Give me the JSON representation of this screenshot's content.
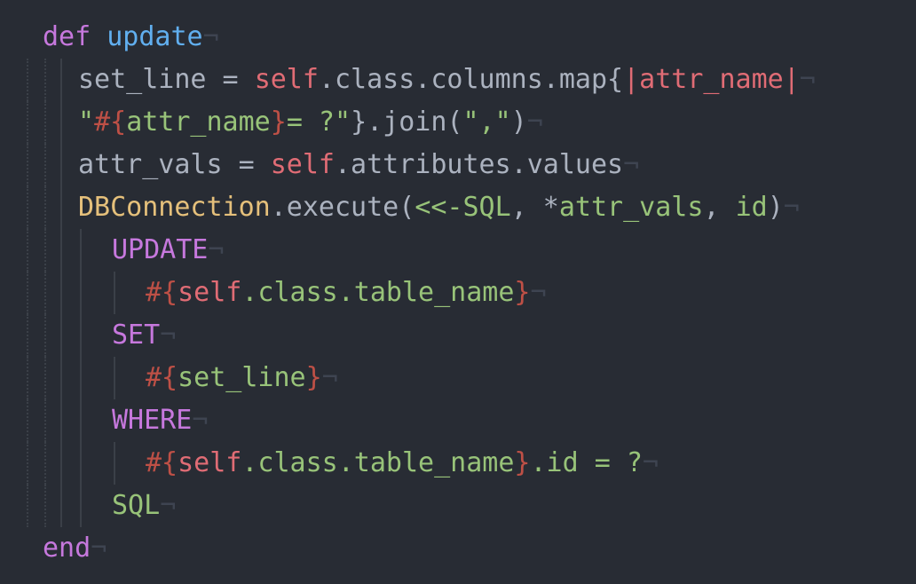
{
  "editor": {
    "language": "ruby",
    "eol_marker": "¬",
    "lines": [
      {
        "tokens": [
          {
            "t": "def",
            "c": "c-kw"
          },
          {
            "t": " ",
            "c": "c-plain"
          },
          {
            "t": "update",
            "c": "c-fn"
          }
        ]
      },
      {
        "tokens": [
          {
            "t": "set_line",
            "c": "c-plain"
          },
          {
            "t": " = ",
            "c": "c-plain"
          },
          {
            "t": "self",
            "c": "c-self"
          },
          {
            "t": ".class.columns.map{",
            "c": "c-plain"
          },
          {
            "t": "|attr_name|",
            "c": "c-var"
          }
        ]
      },
      {
        "tokens": [
          {
            "t": "\"",
            "c": "c-str"
          },
          {
            "t": "#{",
            "c": "c-interp"
          },
          {
            "t": "attr_name",
            "c": "c-str"
          },
          {
            "t": "}",
            "c": "c-interp"
          },
          {
            "t": "= ?\"",
            "c": "c-str"
          },
          {
            "t": "}.join(",
            "c": "c-plain"
          },
          {
            "t": "\",\"",
            "c": "c-str"
          },
          {
            "t": ")",
            "c": "c-plain"
          }
        ]
      },
      {
        "tokens": [
          {
            "t": "attr_vals",
            "c": "c-plain"
          },
          {
            "t": " = ",
            "c": "c-plain"
          },
          {
            "t": "self",
            "c": "c-self"
          },
          {
            "t": ".attributes.values",
            "c": "c-plain"
          }
        ]
      },
      {
        "tokens": [
          {
            "t": "DBConnection",
            "c": "c-const"
          },
          {
            "t": ".execute(",
            "c": "c-plain"
          },
          {
            "t": "<<-SQL",
            "c": "c-heredoc"
          },
          {
            "t": ", *",
            "c": "c-plain"
          },
          {
            "t": "attr_vals",
            "c": "c-str"
          },
          {
            "t": ", ",
            "c": "c-plain"
          },
          {
            "t": "id",
            "c": "c-str"
          },
          {
            "t": ")",
            "c": "c-plain"
          }
        ]
      },
      {
        "tokens": [
          {
            "t": "UPDATE",
            "c": "c-kw"
          }
        ]
      },
      {
        "tokens": [
          {
            "t": "#{",
            "c": "c-interp"
          },
          {
            "t": "self",
            "c": "c-self"
          },
          {
            "t": ".class.table_name",
            "c": "c-str"
          },
          {
            "t": "}",
            "c": "c-interp"
          }
        ]
      },
      {
        "tokens": [
          {
            "t": "SET",
            "c": "c-kw"
          }
        ]
      },
      {
        "tokens": [
          {
            "t": "#{",
            "c": "c-interp"
          },
          {
            "t": "set_line",
            "c": "c-str"
          },
          {
            "t": "}",
            "c": "c-interp"
          }
        ]
      },
      {
        "tokens": [
          {
            "t": "WHERE",
            "c": "c-kw"
          }
        ]
      },
      {
        "tokens": [
          {
            "t": "#{",
            "c": "c-interp"
          },
          {
            "t": "self",
            "c": "c-self"
          },
          {
            "t": ".class.table_name",
            "c": "c-str"
          },
          {
            "t": "}",
            "c": "c-interp"
          },
          {
            "t": ".id = ?",
            "c": "c-str"
          }
        ]
      },
      {
        "tokens": [
          {
            "t": "SQL",
            "c": "c-heredoc"
          }
        ]
      },
      {
        "tokens": [
          {
            "t": "end",
            "c": "c-kw"
          }
        ]
      }
    ]
  }
}
